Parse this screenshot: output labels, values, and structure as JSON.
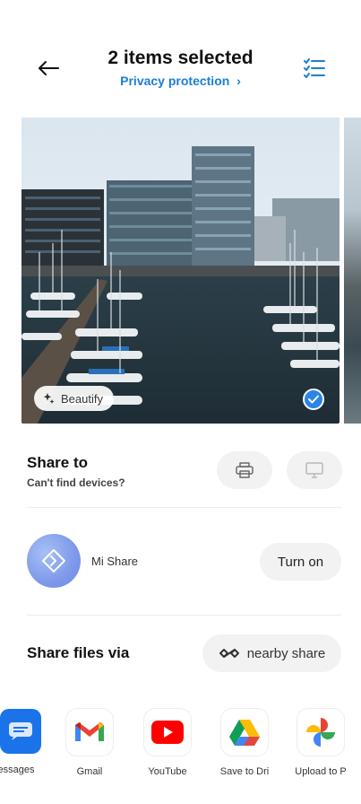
{
  "header": {
    "title": "2 items selected",
    "subtitle": "Privacy protection",
    "subtitle_chevron": "›",
    "back_icon": "arrow-left-icon",
    "select_icon": "select-all-list-icon"
  },
  "photo": {
    "beautify_label": "Beautify",
    "selected": true
  },
  "share_to": {
    "title": "Share to",
    "subtitle": "Can't find devices?"
  },
  "mi_share": {
    "label": "Mi Share",
    "button": "Turn on"
  },
  "share_files": {
    "title": "Share files via",
    "nearby_label": "nearby share"
  },
  "apps": [
    {
      "label": "essages",
      "icon": "messages-icon"
    },
    {
      "label": "Gmail",
      "icon": "gmail-icon"
    },
    {
      "label": "YouTube",
      "icon": "youtube-icon"
    },
    {
      "label": "Save to Dri",
      "icon": "google-drive-icon"
    },
    {
      "label": "Upload to P",
      "icon": "google-photos-icon"
    }
  ],
  "colors": {
    "accent": "#1a7fd6",
    "check": "#2a85e8"
  }
}
